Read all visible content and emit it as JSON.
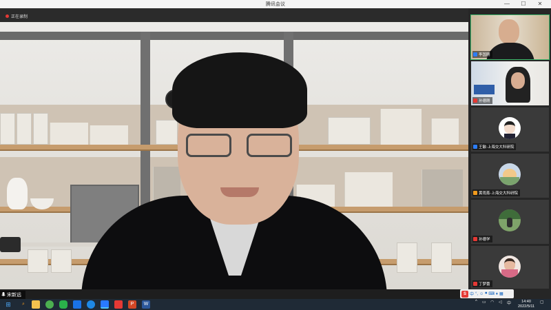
{
  "window": {
    "title": "腾讯会议",
    "minimize": "—",
    "maximize": "☐",
    "close": "✕"
  },
  "recording": {
    "label": "正在录制"
  },
  "main": {
    "speaker_name": "宋新远"
  },
  "participants": [
    {
      "name": "李国刚",
      "active": true,
      "type": "video"
    },
    {
      "name": "孙德刚",
      "active": false,
      "type": "video"
    },
    {
      "name": "王敏-上海交大科研院",
      "active": false,
      "type": "avatar"
    },
    {
      "name": "黄雨蒸-上海交大科研院",
      "active": false,
      "type": "avatar"
    },
    {
      "name": "孙德学",
      "active": false,
      "type": "avatar"
    },
    {
      "name": "丁梦蕾",
      "active": false,
      "type": "avatar"
    }
  ],
  "taskbar": {
    "apps": [
      "windows-start",
      "search",
      "file-explorer",
      "wechat",
      "tencent-meeting",
      "feishu",
      "browser",
      "baidu-netdisk",
      "powerpoint",
      "word"
    ],
    "ime": {
      "logo": "S",
      "mode": "中"
    },
    "time": "14:40",
    "date": "2022/5/11"
  },
  "colors": {
    "active_border": "#3db86b",
    "taskbar": "#1f2a36",
    "sidebar": "#262626"
  }
}
